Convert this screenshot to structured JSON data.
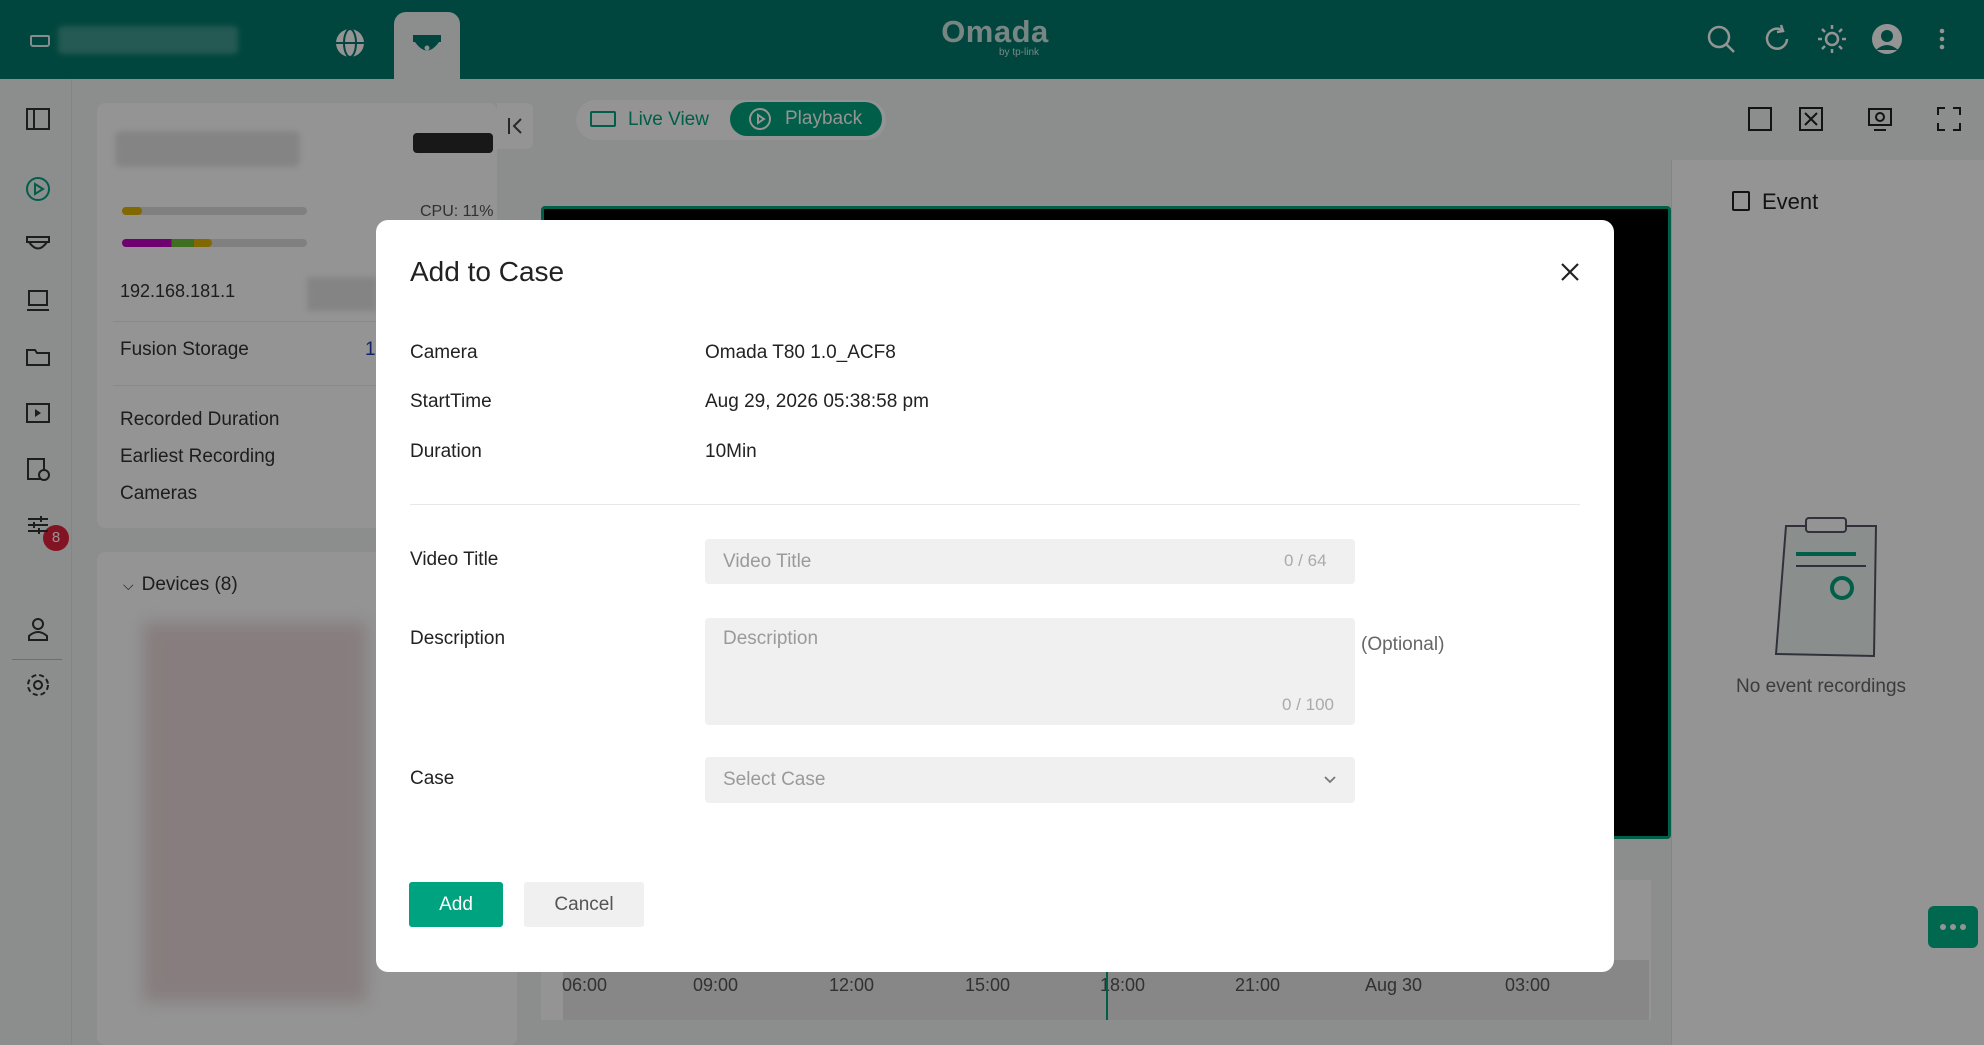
{
  "topbar": {
    "logo_text": "Omada",
    "logo_sub": "by tp-link",
    "icons": [
      "device-icon",
      "globe-icon",
      "camera-dome-icon",
      "search-icon",
      "refresh-icon",
      "theme-sun-icon",
      "user-avatar-icon",
      "more-vertical-icon"
    ]
  },
  "leftnav": {
    "icons": [
      "sidebar-toggle-icon",
      "playback-icon",
      "camera-dome-icon",
      "nvr-icon",
      "folder-icon",
      "video-list-icon",
      "alert-log-icon",
      "sliders-icon",
      "user-icon",
      "settings-gear-icon"
    ],
    "alert_badge": "8"
  },
  "nvr_panel": {
    "cpu_label": "CPU: 11%",
    "ip": "192.168.181.1",
    "storage_label": "Fusion Storage",
    "storage_value": "1",
    "stats": [
      "Recorded Duration",
      "Earliest Recording",
      "Cameras"
    ]
  },
  "devices_panel": {
    "title": "Devices (8)"
  },
  "mode_toggle": {
    "live_view": "Live View",
    "playback": "Playback",
    "active": "playback"
  },
  "timeline": {
    "ticks": [
      "06:00",
      "09:00",
      "12:00",
      "15:00",
      "18:00",
      "21:00",
      "Aug 30",
      "03:00"
    ]
  },
  "event_panel": {
    "title": "Event",
    "empty_text": "No event recordings"
  },
  "modal": {
    "title": "Add to Case",
    "camera_label": "Camera",
    "camera_value": "Omada T80 1.0_ACF8",
    "start_label": "StartTime",
    "start_value": "Aug 29, 2026 05:38:58 pm",
    "duration_label": "Duration",
    "duration_value": "10Min",
    "video_title_label": "Video Title",
    "video_title_placeholder": "Video Title",
    "video_title_counter": "0 / 64",
    "description_label": "Description",
    "description_placeholder": "Description",
    "description_counter": "0 / 100",
    "optional_text": "(Optional)",
    "case_label": "Case",
    "case_placeholder": "Select Case",
    "add_button": "Add",
    "cancel_button": "Cancel"
  },
  "colors": {
    "brand": "#00796b",
    "accent": "#00a37f",
    "badge": "#e0223d"
  }
}
